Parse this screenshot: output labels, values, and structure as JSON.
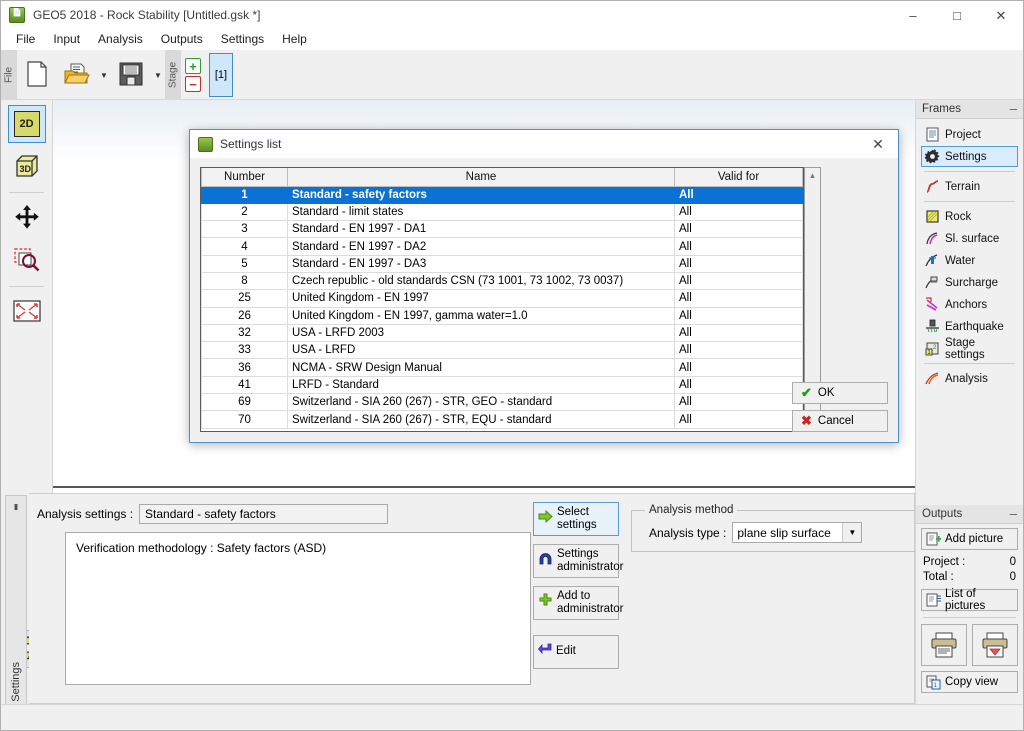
{
  "window": {
    "title": "GEO5 2018 - Rock Stability [Untitled.gsk *]",
    "icon": "geo5-app-icon",
    "minimize": "–",
    "maximize": "□",
    "close": "✕"
  },
  "menubar": {
    "items": [
      {
        "label": "File"
      },
      {
        "label": "Input"
      },
      {
        "label": "Analysis"
      },
      {
        "label": "Outputs"
      },
      {
        "label": "Settings"
      },
      {
        "label": "Help"
      }
    ]
  },
  "toolbar": {
    "file_group_label": "File",
    "new_icon": "new-document-icon",
    "open_icon": "open-folder-icon",
    "save_icon": "save-floppy-icon",
    "dropdown_arrow": "▼",
    "stage_group_label": "Stage",
    "stage_add": "+",
    "stage_remove": "−",
    "stage_current": "[1]"
  },
  "left_toolbar": {
    "items": [
      {
        "name": "view-2d-button",
        "label": "2D",
        "state": "active"
      },
      {
        "name": "view-3d-button",
        "label": "3D",
        "state": "normal"
      },
      {
        "name": "pan-button",
        "label": "",
        "state": "normal"
      },
      {
        "name": "zoom-window-button",
        "label": "",
        "state": "normal"
      },
      {
        "name": "zoom-all-button",
        "label": "",
        "state": "normal"
      },
      {
        "name": "options-gear-button",
        "label": "",
        "state": "pressed"
      }
    ]
  },
  "bottom_tab": {
    "label": "Settings"
  },
  "bottom_panel": {
    "analysis_settings_label": "Analysis settings :",
    "analysis_settings_value": "Standard - safety factors",
    "description": "Verification methodology :  Safety factors (ASD)",
    "buttons": [
      {
        "name": "select-settings-button",
        "line1": "Select",
        "line2": "settings",
        "icon": "green-arrow-icon",
        "primary": true
      },
      {
        "name": "settings-administrator-button",
        "line1": "Settings",
        "line2": "administrator",
        "icon": "magnet-icon",
        "primary": false
      },
      {
        "name": "add-to-administrator-button",
        "line1": "Add to",
        "line2": "administrator",
        "icon": "green-plus-icon",
        "primary": false
      }
    ],
    "edit_button": {
      "label": "Edit",
      "icon": "enter-arrow-icon"
    },
    "analysis_method": {
      "legend": "Analysis method",
      "type_label": "Analysis type :",
      "type_value": "plane slip surface",
      "arrow": "▼"
    }
  },
  "frames_panel": {
    "title": "Frames",
    "minimize": "–",
    "items": [
      {
        "label": "Project",
        "icon": "document-icon",
        "selected": false,
        "sep_after": false
      },
      {
        "label": "Settings",
        "icon": "gear-icon",
        "selected": true,
        "sep_after": true
      },
      {
        "label": "Terrain",
        "icon": "terrain-curve-icon",
        "selected": false,
        "sep_after": true
      },
      {
        "label": "Rock",
        "icon": "rock-block-icon",
        "selected": false,
        "sep_after": false
      },
      {
        "label": "Sl. surface",
        "icon": "slip-surface-icon",
        "selected": false,
        "sep_after": false
      },
      {
        "label": "Water",
        "icon": "water-icon",
        "selected": false,
        "sep_after": false
      },
      {
        "label": "Surcharge",
        "icon": "surcharge-icon",
        "selected": false,
        "sep_after": false
      },
      {
        "label": "Anchors",
        "icon": "anchors-icon",
        "selected": false,
        "sep_after": false
      },
      {
        "label": "Earthquake",
        "icon": "earthquake-icon",
        "selected": false,
        "sep_after": false
      },
      {
        "label": "Stage settings",
        "icon": "stage-settings-icon",
        "selected": false,
        "sep_after": true
      },
      {
        "label": "Analysis",
        "icon": "analysis-icon",
        "selected": false,
        "sep_after": false
      }
    ]
  },
  "outputs_panel": {
    "title": "Outputs",
    "minimize": "–",
    "add_picture": {
      "label": "Add picture",
      "icon": "add-picture-icon"
    },
    "project_label": "Project :",
    "project_value": "0",
    "total_label": "Total :",
    "total_value": "0",
    "list_of_pictures": {
      "label": "List of pictures",
      "icon": "list-pictures-icon"
    },
    "print_button": {
      "name": "print-button",
      "icon": "printer-icon"
    },
    "print_preview_button": {
      "name": "print-preview-button",
      "icon": "printer-preview-icon"
    },
    "copy_view": {
      "label": "Copy view",
      "icon": "copy-view-icon"
    }
  },
  "dialog": {
    "title": "Settings list",
    "icon": "geo5-app-icon",
    "close": "✕",
    "columns": [
      "Number",
      "Name",
      "Valid for"
    ],
    "rows": [
      {
        "number": "1",
        "name": "Standard - safety factors",
        "valid": "All",
        "selected": true
      },
      {
        "number": "2",
        "name": "Standard - limit states",
        "valid": "All",
        "selected": false
      },
      {
        "number": "3",
        "name": "Standard - EN 1997 - DA1",
        "valid": "All",
        "selected": false
      },
      {
        "number": "4",
        "name": "Standard - EN 1997 - DA2",
        "valid": "All",
        "selected": false
      },
      {
        "number": "5",
        "name": "Standard - EN 1997 - DA3",
        "valid": "All",
        "selected": false
      },
      {
        "number": "8",
        "name": "Czech republic - old standards CSN (73 1001, 73 1002, 73 0037)",
        "valid": "All",
        "selected": false
      },
      {
        "number": "25",
        "name": "United Kingdom - EN 1997",
        "valid": "All",
        "selected": false
      },
      {
        "number": "26",
        "name": "United Kingdom - EN 1997, gamma water=1.0",
        "valid": "All",
        "selected": false
      },
      {
        "number": "32",
        "name": "USA - LRFD 2003",
        "valid": "All",
        "selected": false
      },
      {
        "number": "33",
        "name": "USA - LRFD",
        "valid": "All",
        "selected": false
      },
      {
        "number": "36",
        "name": "NCMA - SRW Design Manual",
        "valid": "All",
        "selected": false
      },
      {
        "number": "41",
        "name": "LRFD - Standard",
        "valid": "All",
        "selected": false
      },
      {
        "number": "69",
        "name": "Switzerland - SIA 260 (267) - STR, GEO - standard",
        "valid": "All",
        "selected": false
      },
      {
        "number": "70",
        "name": "Switzerland - SIA 260 (267) - STR, EQU - standard",
        "valid": "All",
        "selected": false
      }
    ],
    "scroll_up": "▲",
    "scroll_down": "▼",
    "ok_button": {
      "label": "OK",
      "icon": "check-icon"
    },
    "cancel_button": {
      "label": "Cancel",
      "icon": "cross-icon"
    }
  },
  "colors": {
    "selection_blue": "#0a72d4",
    "accent_border": "#4a90c4",
    "panel_bg": "#f0f0f0",
    "ok_green": "#1a9b1a",
    "cancel_red": "#c62828"
  }
}
